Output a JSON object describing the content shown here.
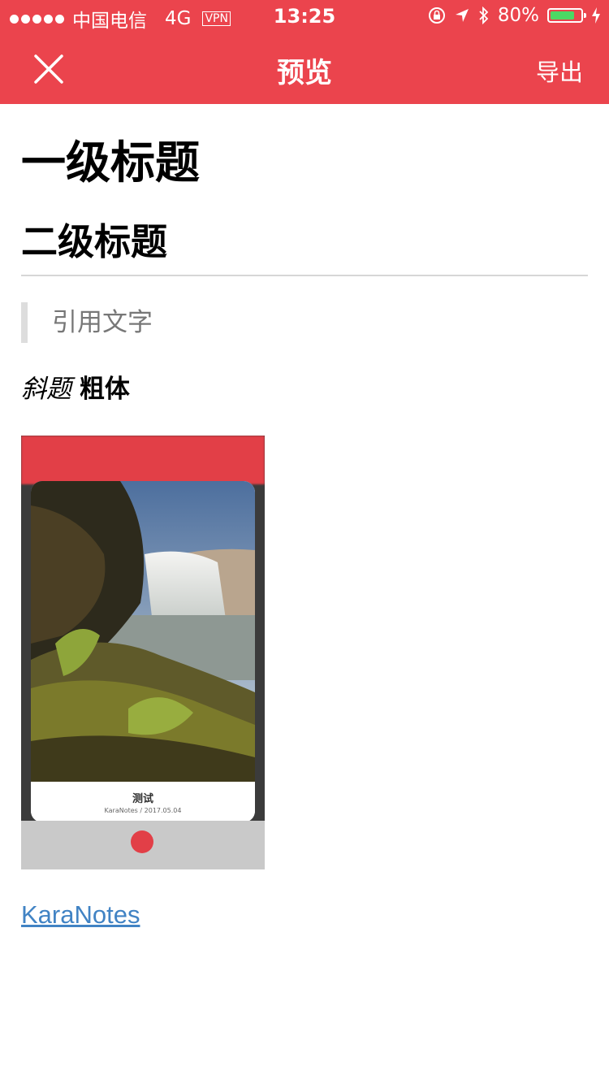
{
  "status_bar": {
    "carrier": "中国电信",
    "network": "4G",
    "vpn": "VPN",
    "time": "13:25",
    "battery_percent": "80%",
    "battery_level": 0.8
  },
  "nav": {
    "title": "预览",
    "export_label": "导出"
  },
  "doc": {
    "h1": "一级标题",
    "h2": "二级标题",
    "quote": "引用文字",
    "italic": "斜题",
    "bold": "粗体",
    "image_title": "测试",
    "image_subtitle": "KaraNotes / 2017.05.04",
    "link": "KaraNotes"
  },
  "colors": {
    "accent": "#eb444d",
    "link": "#4183c4",
    "battery": "#4cd964"
  }
}
